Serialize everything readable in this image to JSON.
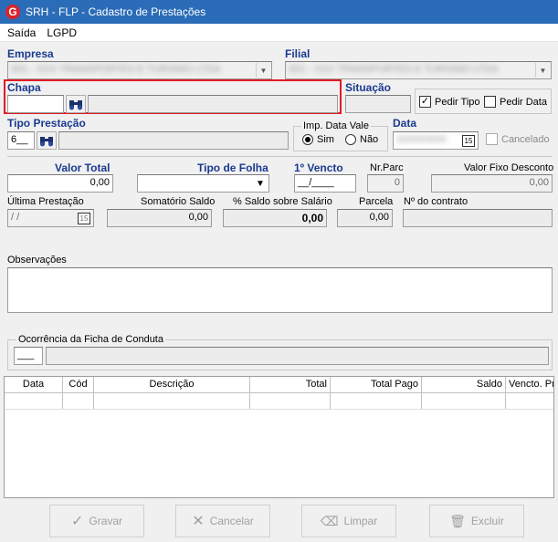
{
  "window": {
    "title": "SRH - FLP - Cadastro de Prestações",
    "logo_letter": "G"
  },
  "menu": [
    "Saída",
    "LGPD"
  ],
  "empresa": {
    "label": "Empresa",
    "value": "001 - XXX TRANSPORTES E TURISMO LTDA"
  },
  "filial": {
    "label": "Filial",
    "value": "001 - XXX TRANSPORTES E TURISMO LTDA"
  },
  "chapa": {
    "label": "Chapa",
    "value": "",
    "name_value": ""
  },
  "situacao": {
    "label": "Situação",
    "value": ""
  },
  "pedir_tipo": {
    "label": "Pedir Tipo",
    "checked": true
  },
  "pedir_data": {
    "label": "Pedir Data",
    "checked": false
  },
  "tipo_prestacao": {
    "label": "Tipo Prestação",
    "code": "6__",
    "desc": ""
  },
  "imp_data_vale": {
    "label": "Imp. Data Vale",
    "sim": "Sim",
    "nao": "Não",
    "selected": "Sim"
  },
  "data": {
    "label": "Data",
    "value": "00/00/0000",
    "cal_icon": "15"
  },
  "cancelado": {
    "label": "Cancelado",
    "checked": false
  },
  "valor_total": {
    "label": "Valor Total",
    "value": "0,00"
  },
  "tipo_folha": {
    "label": "Tipo de Folha",
    "value": ""
  },
  "primeiro_vencto": {
    "label": "1º Vencto",
    "value": "__/____"
  },
  "nr_parc": {
    "label": "Nr.Parc",
    "value": "0"
  },
  "valor_fixo_desconto": {
    "label": "Valor Fixo Desconto",
    "value": "0,00"
  },
  "ultima_prestacao": {
    "label": "Última Prestação",
    "value": " /  /",
    "cal_icon": "15"
  },
  "somatorio_saldo": {
    "label": "Somatório Saldo",
    "value": "0,00"
  },
  "saldo_sobre_salario": {
    "label": "% Saldo sobre Salário",
    "value": "0,00"
  },
  "parcela": {
    "label": "Parcela",
    "value": "0,00"
  },
  "nr_contrato": {
    "label": "Nº do contrato",
    "value": ""
  },
  "observacoes": {
    "label": "Observações",
    "value": ""
  },
  "ocorrencia": {
    "label": "Ocorrência da Ficha de Conduta",
    "code": "___",
    "desc": ""
  },
  "table": {
    "columns": [
      "Data",
      "Cód",
      "Descrição",
      "Total",
      "Total Pago",
      "Saldo",
      "Vencto. Pre"
    ]
  },
  "buttons": {
    "gravar": "Gravar",
    "cancelar": "Cancelar",
    "limpar": "Limpar",
    "excluir": "Excluir"
  },
  "colors": {
    "titlebar": "#2b6cb8",
    "label_blue": "#1a3a8f",
    "highlight": "#e01b24"
  }
}
